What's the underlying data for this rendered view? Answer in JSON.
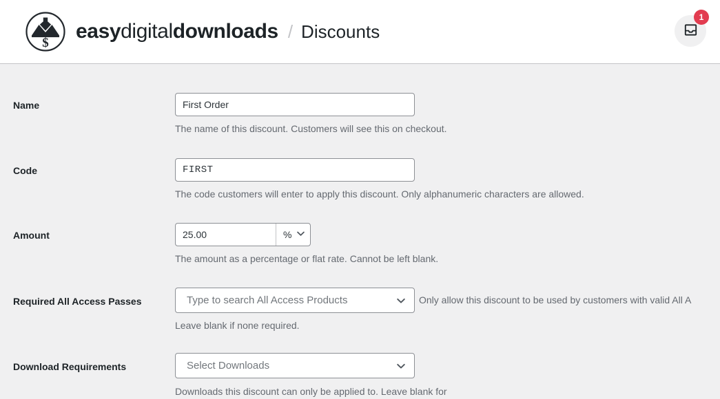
{
  "header": {
    "brand": {
      "logo_icon": "edd-circle-download-dollar-logo",
      "word_easy": "easy",
      "word_digital": "digital",
      "word_downloads": "downloads"
    },
    "breadcrumb_separator": "/",
    "breadcrumb_current": "Discounts",
    "notifications": {
      "icon": "inbox-icon",
      "count": "1",
      "badge_color": "#e23c50"
    }
  },
  "form": {
    "fields": [
      {
        "label": "Name",
        "value": "First Order",
        "description": "The name of this discount. Customers will see this on checkout."
      },
      {
        "label": "Code",
        "value": "FIRST",
        "description": "The code customers will enter to apply this discount. Only alphanumeric characters are allowed."
      },
      {
        "label": "Amount",
        "value": "25.00",
        "unit": "%",
        "unit_caret_icon": "chevron-down-icon",
        "description": "The amount as a percentage or flat rate. Cannot be left blank."
      },
      {
        "label": "Required All Access Passes",
        "placeholder": "Type to search All Access Products",
        "caret_icon": "chevron-down-icon",
        "inline_note": "Only allow this discount to be used by customers with valid All A",
        "sub_note": "Leave blank if none required."
      },
      {
        "label": "Download Requirements",
        "placeholder": "Select Downloads",
        "caret_icon": "chevron-down-icon",
        "description": "Downloads this discount can only be applied to. Leave blank for"
      }
    ]
  },
  "theme": {
    "page_background": "#f0f0f1",
    "header_background": "#ffffff",
    "text_color": "#1d2327",
    "muted_text_color": "#646970",
    "border_color": "#8c8f94"
  }
}
